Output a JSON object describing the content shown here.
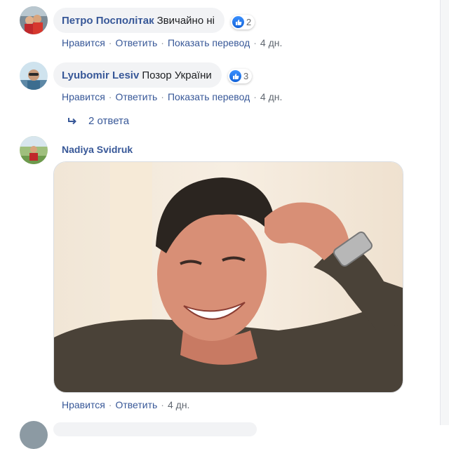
{
  "comments": [
    {
      "author": "Петро Посполітак",
      "text": "Звичайно ні",
      "reaction_count": "2",
      "actions": {
        "like": "Нравится",
        "reply": "Ответить",
        "translate": "Показать перевод",
        "time": "4 дн."
      }
    },
    {
      "author": "Lyubomir Lesiv",
      "text": "Позор України",
      "reaction_count": "3",
      "actions": {
        "like": "Нравится",
        "reply": "Ответить",
        "translate": "Показать перевод",
        "time": "4 дн."
      },
      "replies_label": "2 ответа"
    },
    {
      "author": "Nadiya Svidruk",
      "attachment_icon": "gif-image",
      "actions": {
        "like": "Нравится",
        "reply": "Ответить",
        "time": "4 дн."
      }
    }
  ],
  "separator": "·",
  "colors": {
    "link": "#385898",
    "bubble": "#f2f3f5",
    "like_blue": "#1877f2",
    "muted": "#606770"
  }
}
